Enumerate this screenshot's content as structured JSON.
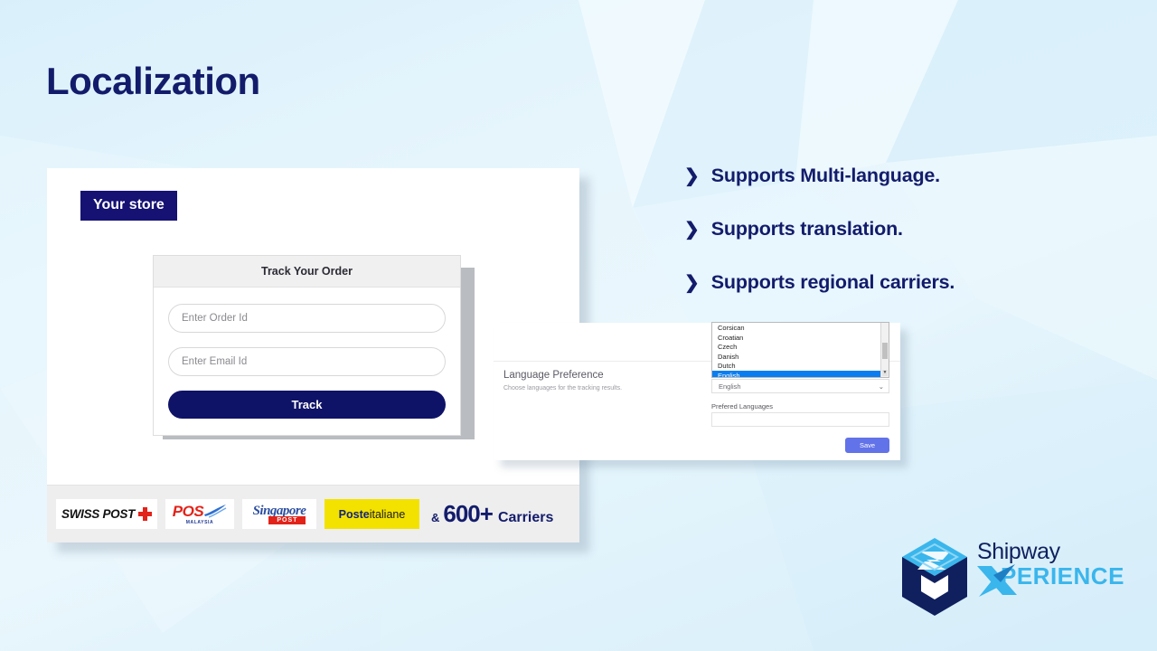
{
  "slide": {
    "title": "Localization",
    "background_color": "#e3f4fc",
    "accent_navy": "#131c6b",
    "accent_blue": "#3ab6ec"
  },
  "bullets": [
    {
      "marker": "chevron-right-icon",
      "text": "Supports Multi-language."
    },
    {
      "marker": "chevron-right-icon",
      "text": "Supports translation."
    },
    {
      "marker": "chevron-right-icon",
      "text": "Supports regional carriers."
    }
  ],
  "store_card": {
    "badge": "Your store",
    "track_form": {
      "header": "Track Your Order",
      "order_id": {
        "value": "",
        "placeholder": "Enter Order Id"
      },
      "email_id": {
        "value": "",
        "placeholder": "Enter Email Id"
      },
      "submit_label": "Track",
      "submit_color": "#0f1368"
    },
    "carriers": {
      "logos": [
        {
          "name": "swiss-post-logo",
          "text": "SWISS POST",
          "color": "#111111",
          "mark_color": "#e2231a"
        },
        {
          "name": "pos-malaysia-logo",
          "text": "POS",
          "sub": "MALAYSIA",
          "color": "#e2231a"
        },
        {
          "name": "singapore-post-logo",
          "text": "Singapore",
          "sub": "POST",
          "color": "#2d4fa0"
        },
        {
          "name": "poste-italiane-logo",
          "text_bold": "Poste",
          "text_light": "italiane",
          "bg": "#f3e200",
          "color": "#14247a"
        }
      ],
      "ampersand": "&",
      "count": "600+",
      "count_label": "Carriers"
    }
  },
  "language_panel": {
    "title": "Language Preference",
    "subtitle": "Choose languages for the tracking results.",
    "dropdown_options": [
      "Corsican",
      "Croatian",
      "Czech",
      "Danish",
      "Dutch",
      "English"
    ],
    "dropdown_selected": "English",
    "select_value": "English",
    "select_chevron": "chevron-down-icon",
    "preferred_label": "Prefered Languages",
    "preferred_value": "",
    "save_label": "Save",
    "save_color": "#6272e8",
    "highlight_color": "#0a7ef0"
  },
  "logo": {
    "brand": "Shipway",
    "product": "PERIENCE",
    "mark": "shipway-box-icon"
  }
}
